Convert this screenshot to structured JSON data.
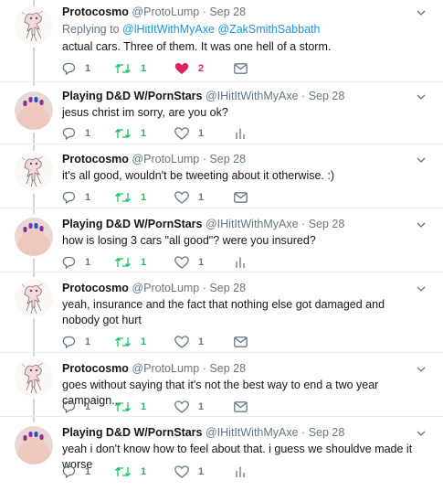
{
  "tweets": [
    {
      "name": "Protocosmo",
      "handle": "@ProtoLump",
      "dot": "·",
      "time": "Sep 28",
      "reply_prefix": "Replying to",
      "reply_mentions": "@lHitItWithMyAxe @ZakSmithSabbath",
      "text": "actual cars. Three of them. It was one hell of a storm.",
      "replies": "1",
      "retweets": "1",
      "likes": "2",
      "liked": true,
      "stat_icon": "mail-icon",
      "avatar": "sketch-avatar"
    },
    {
      "name": "Playing D&D W/PornStars",
      "handle": "@IHitItWithMyAxe",
      "dot": "·",
      "time": "Sep 28",
      "text": "jesus christ im sorry, are you ok?",
      "replies": "1",
      "retweets": "1",
      "likes": "1",
      "liked": false,
      "stat_icon": "analytics-icon",
      "avatar": "nails-avatar"
    },
    {
      "name": "Protocosmo",
      "handle": "@ProtoLump",
      "dot": "·",
      "time": "Sep 28",
      "text": "it's all good, wouldn't be tweeting about it otherwise.  :)",
      "replies": "1",
      "retweets": "1",
      "likes": "1",
      "liked": false,
      "stat_icon": "mail-icon",
      "avatar": "sketch-avatar"
    },
    {
      "name": "Playing D&D W/PornStars",
      "handle": "@IHitItWithMyAxe",
      "dot": "·",
      "time": "Sep 28",
      "text": "how is losing 3 cars \"all good\"? were you insured?",
      "replies": "1",
      "retweets": "1",
      "likes": "1",
      "liked": false,
      "stat_icon": "analytics-icon",
      "avatar": "nails-avatar"
    },
    {
      "name": "Protocosmo",
      "handle": "@ProtoLump",
      "dot": "·",
      "time": "Sep 28",
      "text": "yeah, insurance and the fact that nothing else got damaged and nobody got hurt",
      "replies": "1",
      "retweets": "1",
      "likes": "1",
      "liked": false,
      "stat_icon": "mail-icon",
      "avatar": "sketch-avatar"
    },
    {
      "name": "Protocosmo",
      "handle": "@ProtoLump",
      "dot": "·",
      "time": "Sep 28",
      "text": "goes without saying that it's not the best way to end a two year campaign...",
      "replies": "1",
      "retweets": "1",
      "likes": "1",
      "liked": false,
      "stat_icon": "mail-icon",
      "avatar": "sketch-avatar"
    },
    {
      "name": "Playing D&D W/PornStars",
      "handle": "@IHitItWithMyAxe",
      "dot": "·",
      "time": "Sep 28",
      "text": "yeah i don't know how to feel about that. i guess we shouldve made it worse",
      "replies": "1",
      "retweets": "1",
      "likes": "1",
      "liked": false,
      "stat_icon": "analytics-icon",
      "avatar": "nails-avatar"
    }
  ],
  "colors": {
    "thread_line": "#ccd6dd",
    "mention": "#1b95e0",
    "retweet": "#17bf63",
    "like_active": "#e0245e",
    "muted": "#657786",
    "divider": "#e6ecf0"
  }
}
